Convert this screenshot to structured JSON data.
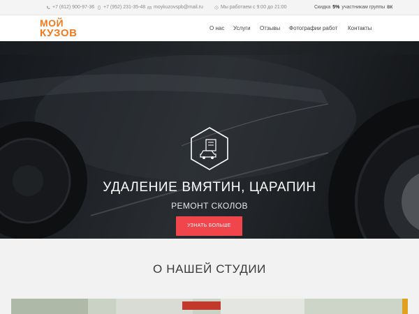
{
  "topbar": {
    "phone1": "+7 (812) 900-97-36",
    "phone2": "+7 (952) 231-35-48",
    "email": "moykuzovspb@mail.ru",
    "hours": "Мы работаем с 9:00 до 21:00",
    "discount_prefix": "Скидка ",
    "discount_value": "5%",
    "discount_suffix": " участникам группы",
    "vk_label": "ВК"
  },
  "logo": {
    "line1": "МОЙ",
    "line2": "КУЗОВ"
  },
  "nav": {
    "items": [
      {
        "label": "О нас"
      },
      {
        "label": "Услуги"
      },
      {
        "label": "Отзывы"
      },
      {
        "label": "Фотографии работ"
      },
      {
        "label": "Контакты"
      }
    ]
  },
  "hero": {
    "title": "УДАЛЕНИЕ ВМЯТИН, ЦАРАПИН",
    "subtitle": "РЕМОНТ СКОЛОВ",
    "button_label": "УЗНАТЬ БОЛЬШЕ"
  },
  "about": {
    "title": "О НАШЕЙ СТУДИИ"
  },
  "colors": {
    "brand": "#f07b1e",
    "accent": "#f0454a"
  }
}
